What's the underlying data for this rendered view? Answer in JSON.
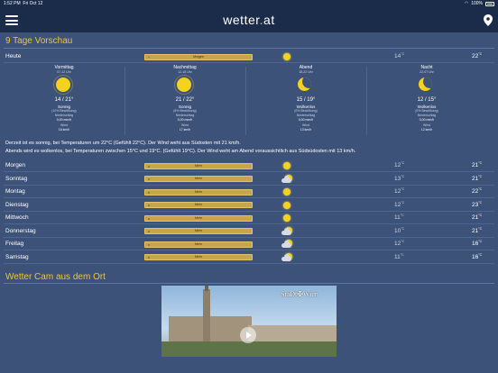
{
  "status": {
    "time": "1:52 PM",
    "date": "Fri Oct 12",
    "battery": "100%"
  },
  "app": {
    "logo_main": "wetter",
    "logo_dot": ".",
    "logo_tld": "at"
  },
  "forecast": {
    "title": "9 Tage Vorschau",
    "today": {
      "day": "Heute",
      "bar": "Morgen",
      "min": "14",
      "max": "22",
      "unit": "°C",
      "icon": "sun-icon"
    },
    "periods": [
      {
        "name": "Vormittag",
        "time": "07-12 Uhr",
        "temps": "14 / 21°",
        "cond": "Sonnig",
        "cond_sub": "(10% Bewölkung)",
        "precip_label": "Niederschlag",
        "precip": "0,00 mm/h",
        "wind_label": "Wind",
        "wind": "16 km/h",
        "icon": "sun-icon"
      },
      {
        "name": "Nachmittag",
        "time": "12-18 Uhr",
        "temps": "21 / 22°",
        "cond": "Sonnig",
        "cond_sub": "(8% Bewölkung)",
        "precip_label": "Niederschlag",
        "precip": "0,00 mm/h",
        "wind_label": "Wind",
        "wind": "17 km/h",
        "icon": "sun-icon"
      },
      {
        "name": "Abend",
        "time": "18-22 Uhr",
        "temps": "15 / 19°",
        "cond": "Wolkenlos",
        "cond_sub": "(0% Bewölkung)",
        "precip_label": "Niederschlag",
        "precip": "0,00 mm/h",
        "wind_label": "Wind",
        "wind": "13 km/h",
        "icon": "moon-icon"
      },
      {
        "name": "Nacht",
        "time": "22-07 Uhr",
        "temps": "12 / 15°",
        "cond": "Wolkenlos",
        "cond_sub": "(0% Bewölkung)",
        "precip_label": "Niederschlag",
        "precip": "0,00 mm/h",
        "wind_label": "Wind",
        "wind": "12 km/h",
        "icon": "moon-icon"
      }
    ],
    "description_line1": "Derzeit ist es sonnig, bei Temperaturen um 22°C (Gefühlt 22°C). Der Wind weht aus Südosten mit 21 km/h.",
    "description_line2": "Abends wird es wolkenlos, bei Temperaturen zwischen 15°C und 19°C. (Gefühlt 19°C). Der Wind weht am Abend voraussichtlich aus Südsüdosten mit 13 km/h.",
    "days": [
      {
        "day": "Morgen",
        "bar": "Mehr",
        "min": "12",
        "max": "21",
        "icon": "sun-icon"
      },
      {
        "day": "Sonntag",
        "bar": "Mehr",
        "min": "13",
        "max": "21",
        "icon": "partly-cloudy-icon"
      },
      {
        "day": "Montag",
        "bar": "Mehr",
        "min": "12",
        "max": "22",
        "icon": "sun-icon"
      },
      {
        "day": "Dienstag",
        "bar": "Mehr",
        "min": "12",
        "max": "23",
        "icon": "sun-icon"
      },
      {
        "day": "Mittwoch",
        "bar": "Mehr",
        "min": "11",
        "max": "21",
        "icon": "sun-icon"
      },
      {
        "day": "Donnerstag",
        "bar": "Mehr",
        "min": "10",
        "max": "21",
        "icon": "partly-cloudy-icon"
      },
      {
        "day": "Freitag",
        "bar": "Mehr",
        "min": "12",
        "max": "16",
        "icon": "partly-cloudy-icon"
      },
      {
        "day": "Samstag",
        "bar": "Mehr",
        "min": "11",
        "max": "16",
        "icon": "partly-cloudy-icon"
      }
    ],
    "unit": "°C"
  },
  "webcam": {
    "title": "Wetter Cam aus dem Ort",
    "overlay": "StaDt✠Wien"
  },
  "colors": {
    "accent": "#f2c919",
    "background": "#3d5278",
    "navbar": "#1b2c4a",
    "bar": "#c8a54a"
  }
}
